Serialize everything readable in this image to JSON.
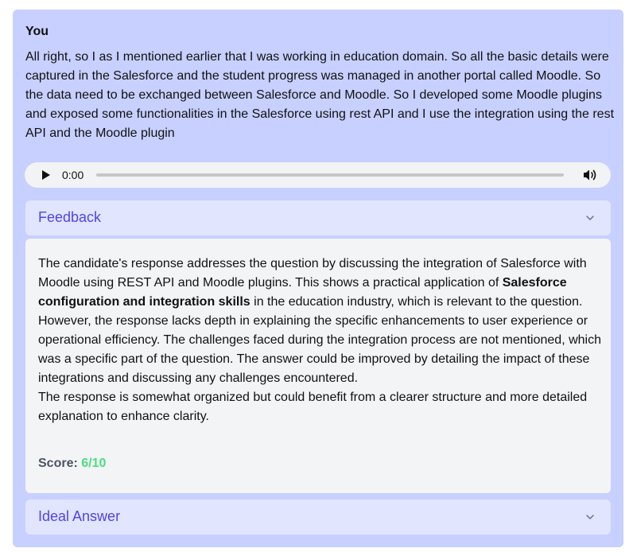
{
  "message": {
    "speaker": "You",
    "transcript": "All right, so I as I mentioned earlier that I was working in education domain. So all the basic details were captured in the Salesforce and the student progress was managed in another portal called Moodle. So the data need to be exchanged between Salesforce and Moodle. So I developed some Moodle plugins and exposed some functionalities in the Salesforce using rest API and I use the integration using the rest API and the Moodle plugin"
  },
  "audio": {
    "time": "0:00",
    "progress_percent": 0
  },
  "feedback": {
    "title": "Feedback",
    "text_part1": "The candidate's response addresses the question by discussing the integration of Salesforce with Moodle using REST API and Moodle plugins. This shows a practical application of ",
    "text_bold": "Salesforce configuration and integration skills",
    "text_part2": " in the education industry, which is relevant to the question. However, the response lacks depth in explaining the specific enhancements to user experience or operational efficiency. The challenges faced during the integration process are not mentioned, which was a specific part of the question. The answer could be improved by detailing the impact of these integrations and discussing any challenges encountered.",
    "text_para2": "The response is somewhat organized but could benefit from a clearer structure and more detailed explanation to enhance clarity.",
    "score_label": "Score: ",
    "score_value": "6/10"
  },
  "ideal_answer": {
    "title": "Ideal Answer"
  },
  "colors": {
    "card_bg": "#c7d0fe",
    "accordion_bg": "#e1e5fe",
    "accent": "#4f46e5",
    "score_green": "#4ade80"
  },
  "icons": {
    "play": "play-icon",
    "volume": "volume-icon",
    "chevron": "chevron-down-icon"
  }
}
